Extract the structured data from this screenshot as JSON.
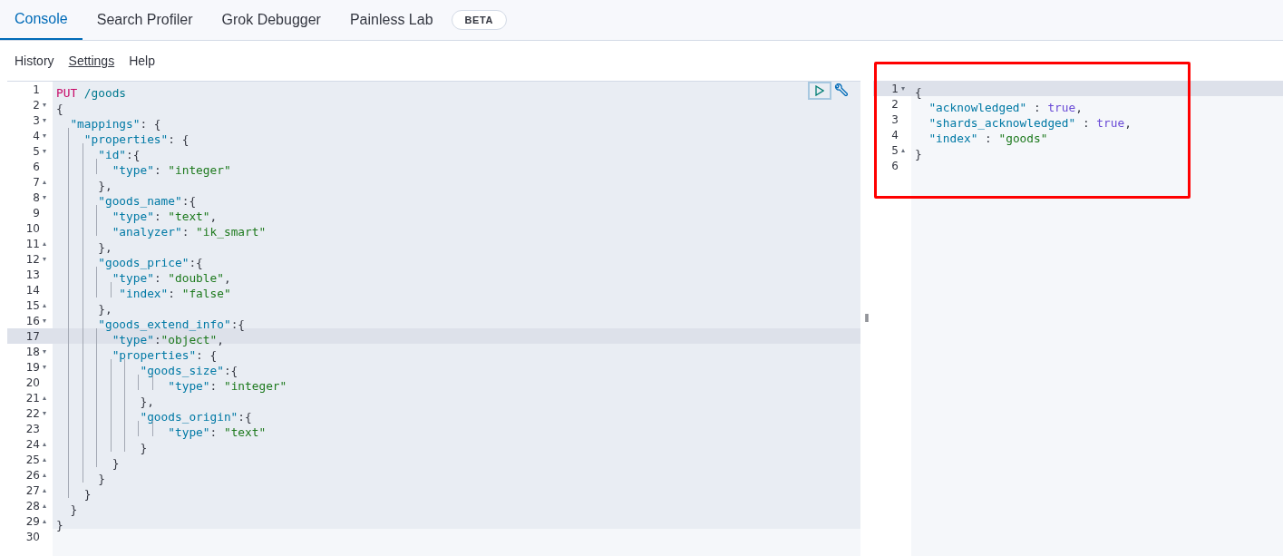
{
  "tabs": [
    {
      "label": "Console",
      "selected": true
    },
    {
      "label": "Search Profiler",
      "selected": false
    },
    {
      "label": "Grok Debugger",
      "selected": false
    },
    {
      "label": "Painless Lab",
      "selected": false,
      "badge": "BETA"
    }
  ],
  "menu": [
    {
      "label": "History",
      "selected": false
    },
    {
      "label": "Settings",
      "selected": true
    },
    {
      "label": "Help",
      "selected": false
    }
  ],
  "request_editor": {
    "lines": [
      {
        "number": "1",
        "tokens": [
          {
            "kind": "method",
            "text": "PUT"
          },
          {
            "kind": "path",
            "text": " /goods"
          }
        ]
      },
      {
        "number": "2",
        "fold": "▾",
        "tokens": [
          {
            "kind": "punct",
            "text": "{"
          }
        ]
      },
      {
        "number": "3",
        "fold": "▾",
        "tokens": [
          {
            "kind": "key",
            "text": "  \"mappings\""
          },
          {
            "kind": "punct",
            "text": ": {"
          }
        ]
      },
      {
        "number": "4",
        "fold": "▾",
        "tokens": [
          {
            "kind": "key",
            "text": "    \"properties\""
          },
          {
            "kind": "punct",
            "text": ": {"
          }
        ]
      },
      {
        "number": "5",
        "fold": "▾",
        "tokens": [
          {
            "kind": "key",
            "text": "      \"id\""
          },
          {
            "kind": "punct",
            "text": ":{"
          }
        ]
      },
      {
        "number": "6",
        "tokens": [
          {
            "kind": "key",
            "text": "        \"type\""
          },
          {
            "kind": "punct",
            "text": ": "
          },
          {
            "kind": "string",
            "text": "\"integer\""
          }
        ]
      },
      {
        "number": "7",
        "fold": "▴",
        "tokens": [
          {
            "kind": "punct",
            "text": "      },"
          }
        ]
      },
      {
        "number": "8",
        "fold": "▾",
        "tokens": [
          {
            "kind": "key",
            "text": "      \"goods_name\""
          },
          {
            "kind": "punct",
            "text": ":{"
          }
        ]
      },
      {
        "number": "9",
        "tokens": [
          {
            "kind": "key",
            "text": "        \"type\""
          },
          {
            "kind": "punct",
            "text": ": "
          },
          {
            "kind": "string",
            "text": "\"text\""
          },
          {
            "kind": "punct",
            "text": ","
          }
        ]
      },
      {
        "number": "10",
        "tokens": [
          {
            "kind": "key",
            "text": "        \"analyzer\""
          },
          {
            "kind": "punct",
            "text": ": "
          },
          {
            "kind": "string",
            "text": "\"ik_smart\""
          }
        ]
      },
      {
        "number": "11",
        "fold": "▴",
        "tokens": [
          {
            "kind": "punct",
            "text": "      },"
          }
        ]
      },
      {
        "number": "12",
        "fold": "▾",
        "tokens": [
          {
            "kind": "key",
            "text": "      \"goods_price\""
          },
          {
            "kind": "punct",
            "text": ":{"
          }
        ]
      },
      {
        "number": "13",
        "tokens": [
          {
            "kind": "key",
            "text": "        \"type\""
          },
          {
            "kind": "punct",
            "text": ": "
          },
          {
            "kind": "string",
            "text": "\"double\""
          },
          {
            "kind": "punct",
            "text": ","
          }
        ]
      },
      {
        "number": "14",
        "tokens": [
          {
            "kind": "key",
            "text": "         \"index\""
          },
          {
            "kind": "punct",
            "text": ": "
          },
          {
            "kind": "string",
            "text": "\"false\""
          }
        ]
      },
      {
        "number": "15",
        "fold": "▴",
        "tokens": [
          {
            "kind": "punct",
            "text": "      },"
          }
        ]
      },
      {
        "number": "16",
        "fold": "▾",
        "tokens": [
          {
            "kind": "key",
            "text": "      \"goods_extend_info\""
          },
          {
            "kind": "punct",
            "text": ":{"
          }
        ]
      },
      {
        "number": "17",
        "current": true,
        "tokens": [
          {
            "kind": "key",
            "text": "        \"type\""
          },
          {
            "kind": "punct",
            "text": ":"
          },
          {
            "kind": "string",
            "text": "\"object\""
          },
          {
            "kind": "punct",
            "text": ","
          }
        ]
      },
      {
        "number": "18",
        "fold": "▾",
        "tokens": [
          {
            "kind": "key",
            "text": "        \"properties\""
          },
          {
            "kind": "punct",
            "text": ": {"
          }
        ]
      },
      {
        "number": "19",
        "fold": "▾",
        "tokens": [
          {
            "kind": "key",
            "text": "            \"goods_size\""
          },
          {
            "kind": "punct",
            "text": ":{"
          }
        ]
      },
      {
        "number": "20",
        "tokens": [
          {
            "kind": "key",
            "text": "                \"type\""
          },
          {
            "kind": "punct",
            "text": ": "
          },
          {
            "kind": "string",
            "text": "\"integer\""
          }
        ]
      },
      {
        "number": "21",
        "fold": "▴",
        "tokens": [
          {
            "kind": "punct",
            "text": "            },"
          }
        ]
      },
      {
        "number": "22",
        "fold": "▾",
        "tokens": [
          {
            "kind": "key",
            "text": "            \"goods_origin\""
          },
          {
            "kind": "punct",
            "text": ":{"
          }
        ]
      },
      {
        "number": "23",
        "tokens": [
          {
            "kind": "key",
            "text": "                \"type\""
          },
          {
            "kind": "punct",
            "text": ": "
          },
          {
            "kind": "string",
            "text": "\"text\""
          }
        ]
      },
      {
        "number": "24",
        "fold": "▴",
        "tokens": [
          {
            "kind": "punct",
            "text": "            }"
          }
        ]
      },
      {
        "number": "25",
        "fold": "▴",
        "tokens": [
          {
            "kind": "punct",
            "text": "        }"
          }
        ]
      },
      {
        "number": "26",
        "fold": "▴",
        "tokens": [
          {
            "kind": "punct",
            "text": "      }"
          }
        ]
      },
      {
        "number": "27",
        "fold": "▴",
        "tokens": [
          {
            "kind": "punct",
            "text": "    }"
          }
        ]
      },
      {
        "number": "28",
        "fold": "▴",
        "tokens": [
          {
            "kind": "punct",
            "text": "  }"
          }
        ]
      },
      {
        "number": "29",
        "fold": "▴",
        "tokens": [
          {
            "kind": "punct",
            "text": "}"
          }
        ]
      },
      {
        "number": "30",
        "blank": true
      }
    ]
  },
  "response_editor": {
    "lines": [
      {
        "number": "1",
        "fold": "▾",
        "current": true,
        "tokens": [
          {
            "kind": "punct",
            "text": "{"
          }
        ]
      },
      {
        "number": "2",
        "tokens": [
          {
            "kind": "key",
            "text": "  \"acknowledged\""
          },
          {
            "kind": "punct",
            "text": " : "
          },
          {
            "kind": "bool",
            "text": "true"
          },
          {
            "kind": "punct",
            "text": ","
          }
        ]
      },
      {
        "number": "3",
        "tokens": [
          {
            "kind": "key",
            "text": "  \"shards_acknowledged\""
          },
          {
            "kind": "punct",
            "text": " : "
          },
          {
            "kind": "bool",
            "text": "true"
          },
          {
            "kind": "punct",
            "text": ","
          }
        ]
      },
      {
        "number": "4",
        "tokens": [
          {
            "kind": "key",
            "text": "  \"index\""
          },
          {
            "kind": "punct",
            "text": " : "
          },
          {
            "kind": "string",
            "text": "\"goods\""
          }
        ]
      },
      {
        "number": "5",
        "fold": "▴",
        "tokens": [
          {
            "kind": "punct",
            "text": "}"
          }
        ]
      },
      {
        "number": "6"
      }
    ]
  },
  "splitter": "‖"
}
